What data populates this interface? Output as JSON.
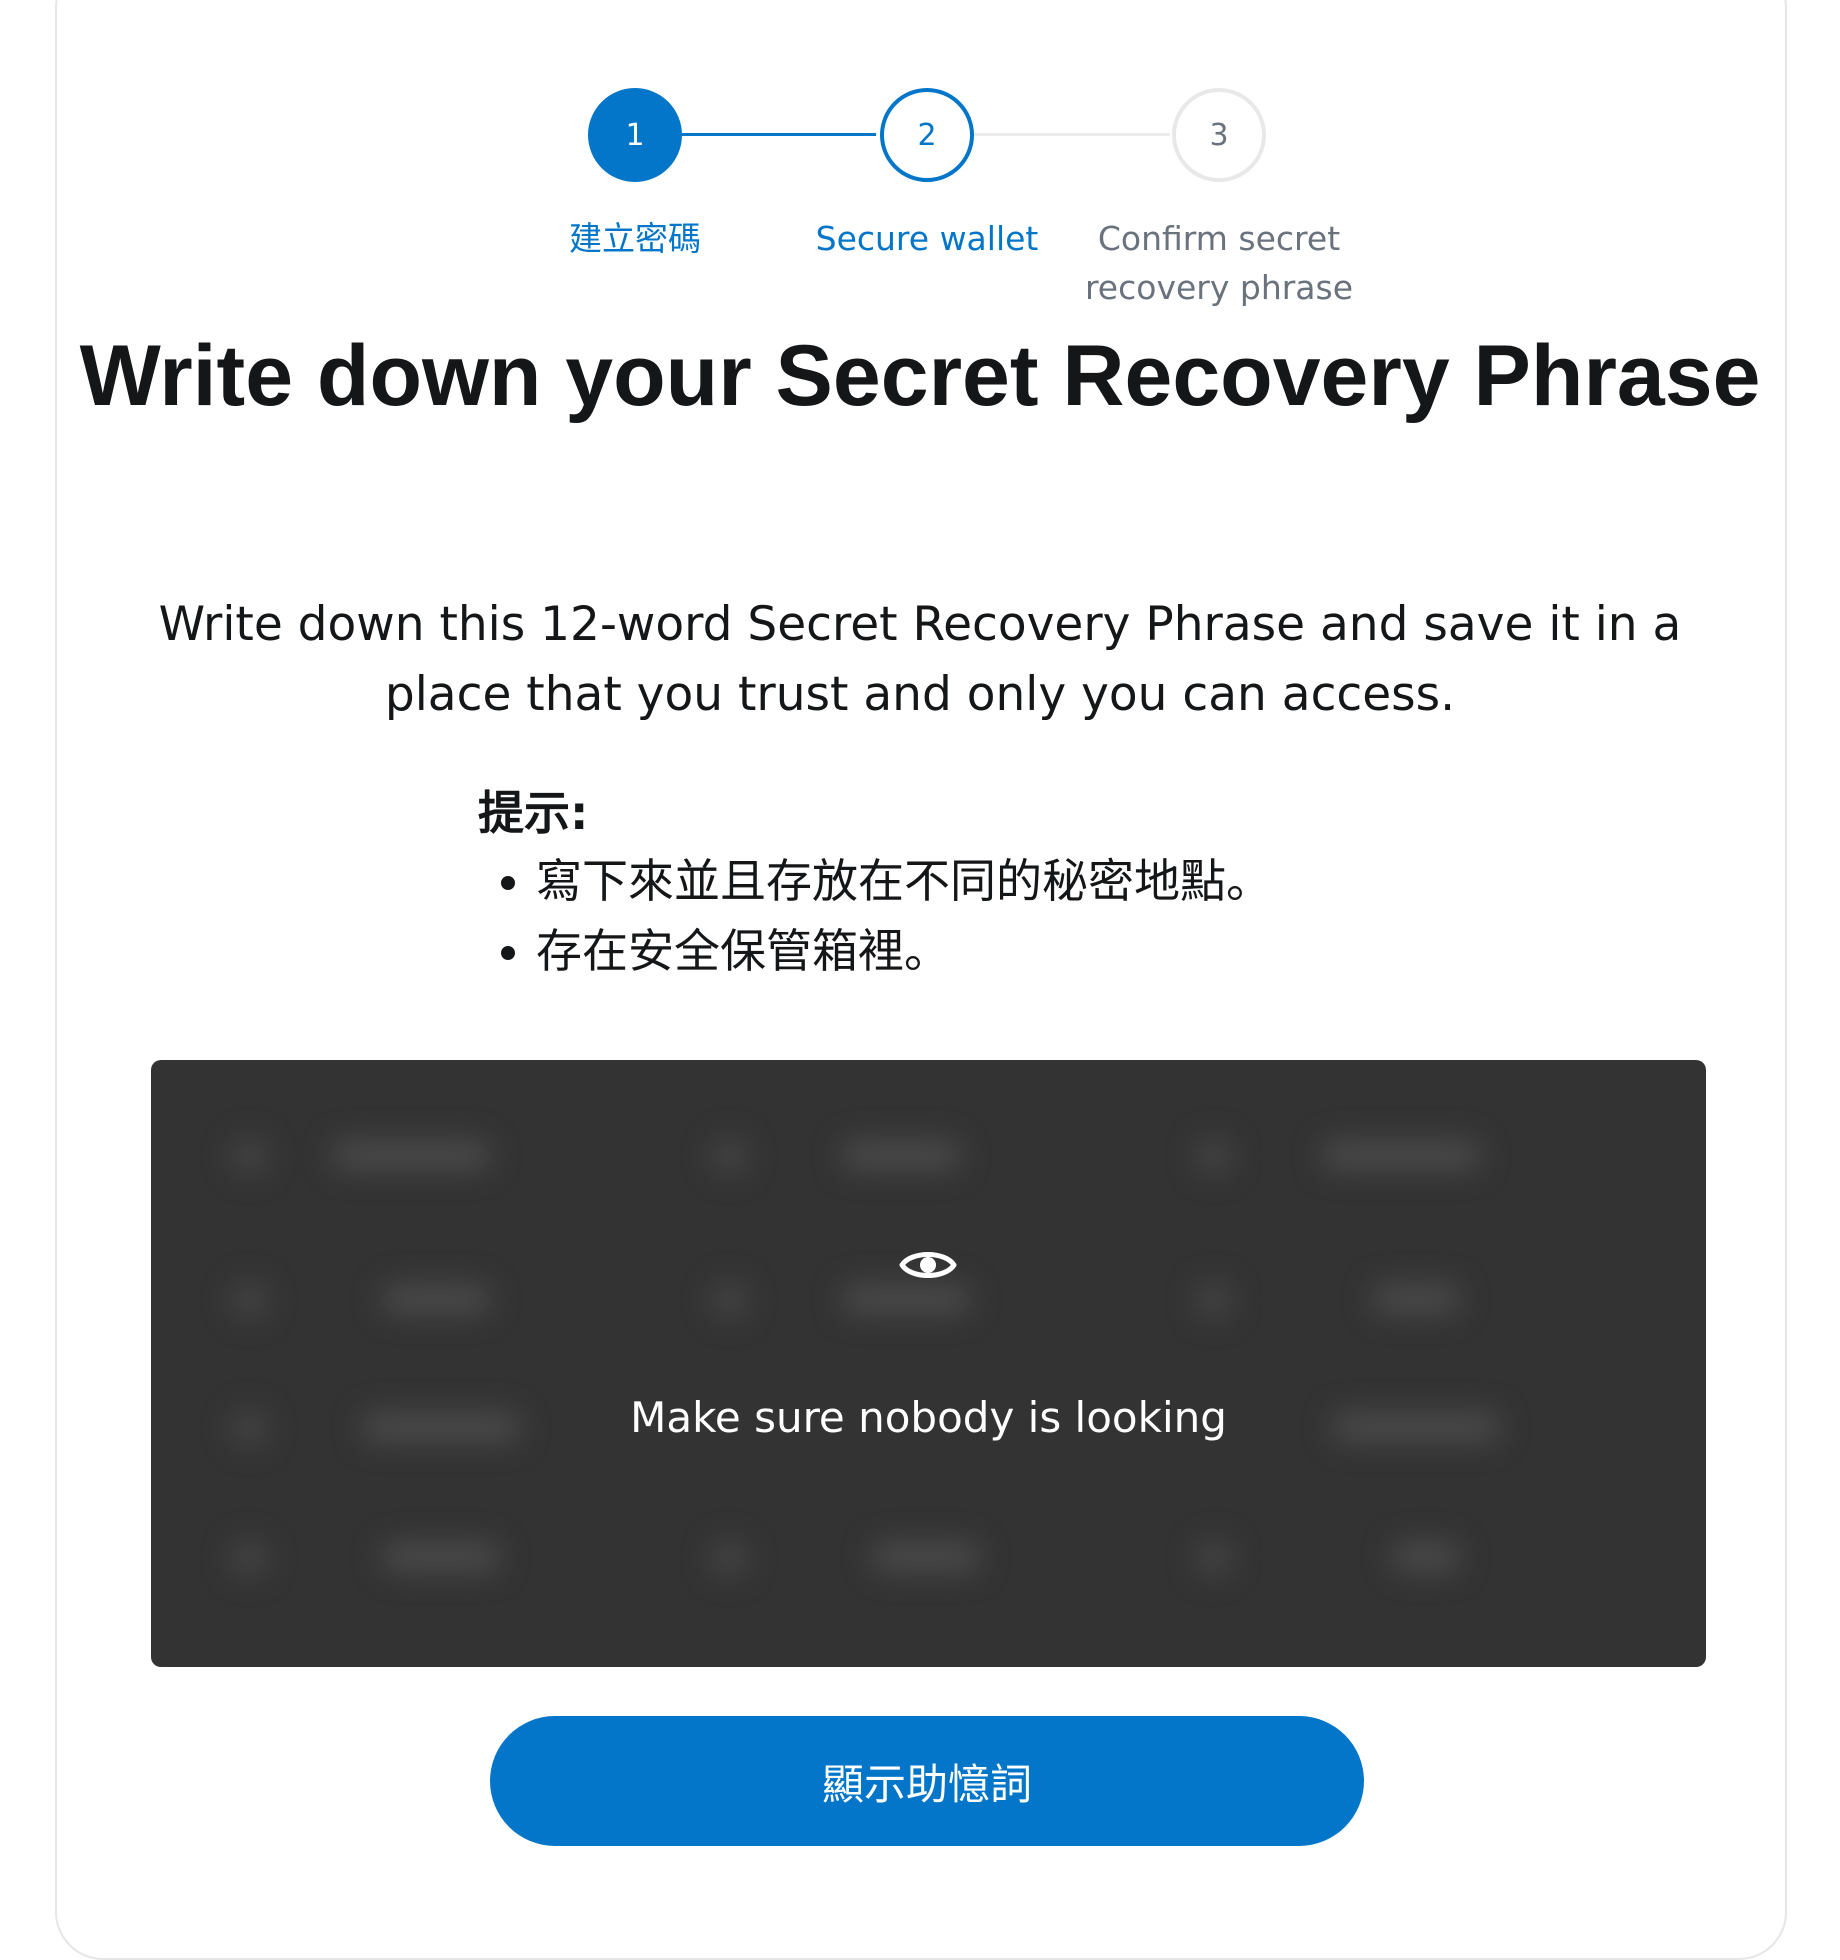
{
  "stepper": {
    "steps": [
      {
        "number": "1",
        "label": "建立密碼",
        "state": "completed"
      },
      {
        "number": "2",
        "label": "Secure wallet",
        "state": "current"
      },
      {
        "number": "3",
        "label": "Confirm secret recovery phrase",
        "state": "pending"
      }
    ]
  },
  "title": "Write down your Secret Recovery Phrase",
  "description": "Write down this 12-word Secret Recovery Phrase and save it in a place that you trust and only you can access.",
  "tips": {
    "title": "提示:",
    "items": [
      "寫下來並且存放在不同的秘密地點。",
      "存在安全保管箱裡。"
    ]
  },
  "srp_box": {
    "icon": "eye-icon",
    "message": "Make sure nobody is looking",
    "background": "#333333"
  },
  "reveal_button": {
    "label": "顯示助憶詞"
  },
  "colors": {
    "accent": "#0376c9",
    "text": "#141618",
    "muted": "#6a737d"
  }
}
